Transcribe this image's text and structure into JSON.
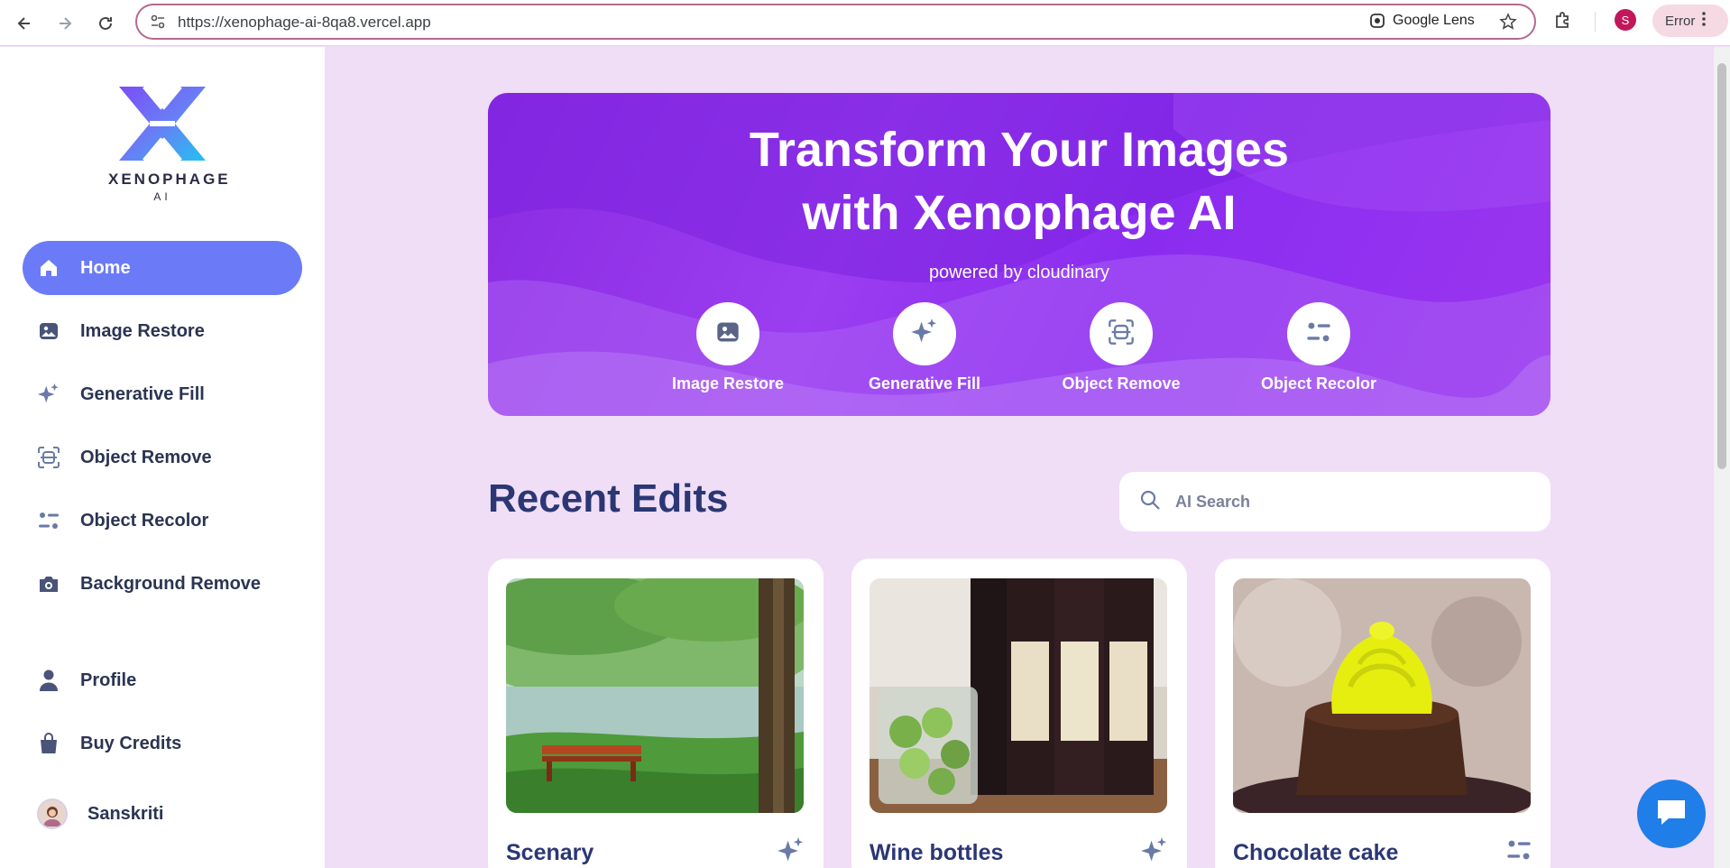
{
  "browser": {
    "url": "https://xenophage-ai-8qa8.vercel.app",
    "lens_label": "Google Lens",
    "profile_initial": "S",
    "error_label": "Error"
  },
  "sidebar": {
    "logo_text": "XENOPHAGE",
    "logo_sub": "AI",
    "items": [
      {
        "label": "Home",
        "icon": "home-icon",
        "active": true
      },
      {
        "label": "Image Restore",
        "icon": "image-icon"
      },
      {
        "label": "Generative Fill",
        "icon": "sparkles-icon"
      },
      {
        "label": "Object Remove",
        "icon": "scan-icon"
      },
      {
        "label": "Object Recolor",
        "icon": "filters-icon"
      },
      {
        "label": "Background Remove",
        "icon": "camera-icon"
      }
    ],
    "bottom_items": [
      {
        "label": "Profile",
        "icon": "user-icon"
      },
      {
        "label": "Buy Credits",
        "icon": "bag-icon"
      }
    ],
    "user_name": "Sanskriti"
  },
  "hero": {
    "title_line1": "Transform Your Images",
    "title_line2": "with Xenophage AI",
    "subtitle": "powered by cloudinary",
    "actions": [
      {
        "label": "Image Restore",
        "icon": "image-icon"
      },
      {
        "label": "Generative Fill",
        "icon": "sparkles-icon"
      },
      {
        "label": "Object Remove",
        "icon": "scan-icon"
      },
      {
        "label": "Object Recolor",
        "icon": "filters-icon"
      }
    ]
  },
  "recent": {
    "title": "Recent Edits",
    "search_placeholder": "AI Search",
    "cards": [
      {
        "title": "Scenary",
        "icon": "sparkles-icon"
      },
      {
        "title": "Wine bottles",
        "icon": "sparkles-icon"
      },
      {
        "title": "Chocolate cake",
        "icon": "filters-icon"
      }
    ]
  },
  "colors": {
    "accent": "#6b7bf7",
    "heading": "#2b3774",
    "hero": "#8a2be2",
    "background": "#f0ddf6"
  }
}
